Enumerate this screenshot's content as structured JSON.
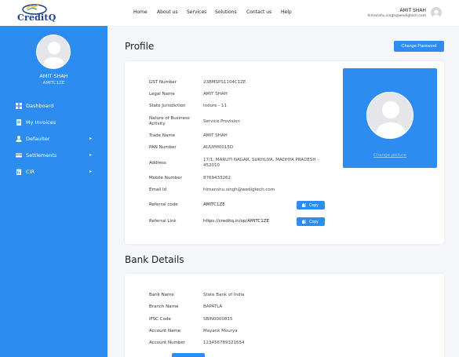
{
  "header": {
    "logo_text": "CreditQ",
    "nav": [
      "Home",
      "About us",
      "Services",
      "Solutions",
      "Contact us",
      "Help"
    ],
    "user_name": "AMIT SHAH",
    "user_email": "himanshu.singh@wedigtech.com"
  },
  "sidebar": {
    "name": "AMIT SHAH",
    "code": "AMITC1ZE",
    "items": [
      {
        "label": "Dashboard",
        "icon": "grid-icon"
      },
      {
        "label": "My Invoices",
        "icon": "invoice-icon"
      },
      {
        "label": "Defaulter",
        "icon": "user-icon"
      },
      {
        "label": "Settlements",
        "icon": "settlement-icon"
      },
      {
        "label": "CIR",
        "icon": "report-icon"
      }
    ]
  },
  "profile": {
    "title": "Profile",
    "change_password": "Change Password",
    "change_picture": "Change picture",
    "fields": [
      {
        "label": "GST Number",
        "value": "23BMSPS1104C1ZE"
      },
      {
        "label": "Legal Name",
        "value": "AMIT SHAH"
      },
      {
        "label": "State Jurisdiction",
        "value": "Indore - 11"
      },
      {
        "label": "Nature of Business Activity",
        "value": "Service Provision"
      },
      {
        "label": "Trade Name",
        "value": "AMIT SHAH"
      },
      {
        "label": "PAN Number",
        "value": "AUUPM0015D"
      },
      {
        "label": "Address",
        "value": "17/1, MARUTI NAGAR, SUKHLIYA, MADHYA PRADESH - 452010"
      },
      {
        "label": "Mobile Number",
        "value": "8769433262"
      },
      {
        "label": "Email Id",
        "value": "himanshu.singh@wedigtech.com"
      },
      {
        "label": "Referral code",
        "value": "AMITC1ZE"
      },
      {
        "label": "Referral Link",
        "value": "https://creditq.in/op/AMITC1ZE"
      }
    ],
    "copy_label": "Copy"
  },
  "bank": {
    "title": "Bank Details",
    "fields": [
      {
        "label": "Bank Name",
        "value": "State Bank of India"
      },
      {
        "label": "Branch Name",
        "value": "BAPATLA"
      },
      {
        "label": "IFSC Code",
        "value": "SBIN0000815"
      },
      {
        "label": "Account Name",
        "value": "Mayank Mourya"
      },
      {
        "label": "Account Number",
        "value": "123456789321654"
      }
    ]
  },
  "colors": {
    "primary": "#2c8cf0",
    "background": "#f4f6fa"
  }
}
